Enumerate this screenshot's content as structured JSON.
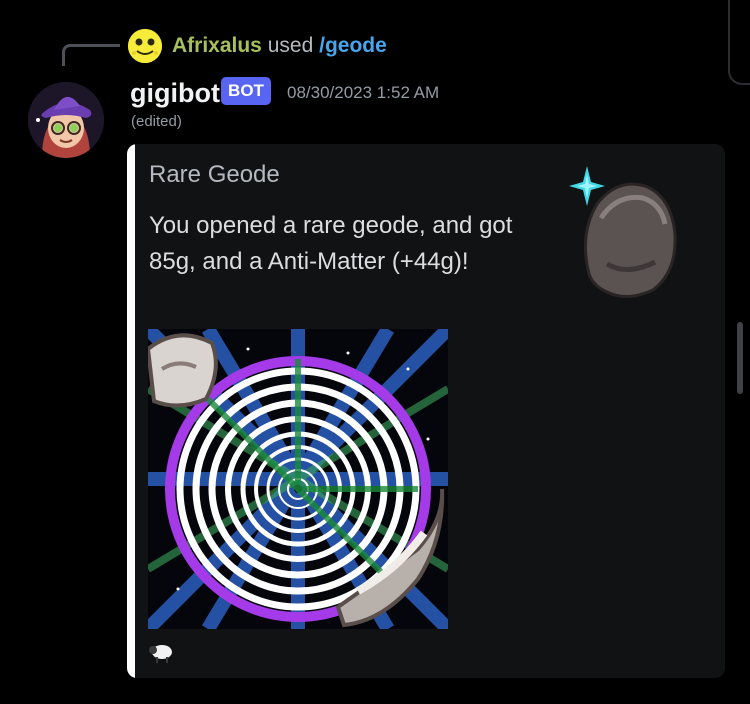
{
  "reply": {
    "username": "Afrixalus",
    "verb": "used",
    "command": "/geode"
  },
  "message": {
    "author": "gigibot",
    "bot_tag": "BOT",
    "timestamp": "08/30/2023 1:52 AM",
    "edited": "(edited)"
  },
  "embed": {
    "title": "Rare Geode",
    "description": "You opened a rare geode, and got 85g, and a Anti-Matter (+44g)!",
    "accent_color": "#ffffff",
    "thumbnail_icon": "sparkling-geode-icon",
    "image_icon": "anti-matter-spiral-image",
    "footer_icon": "sheep-icon"
  },
  "colors": {
    "background": "#000000",
    "reply_user": "#a6c05c",
    "command": "#46a6ee",
    "bot_tag": "#5865f2"
  }
}
